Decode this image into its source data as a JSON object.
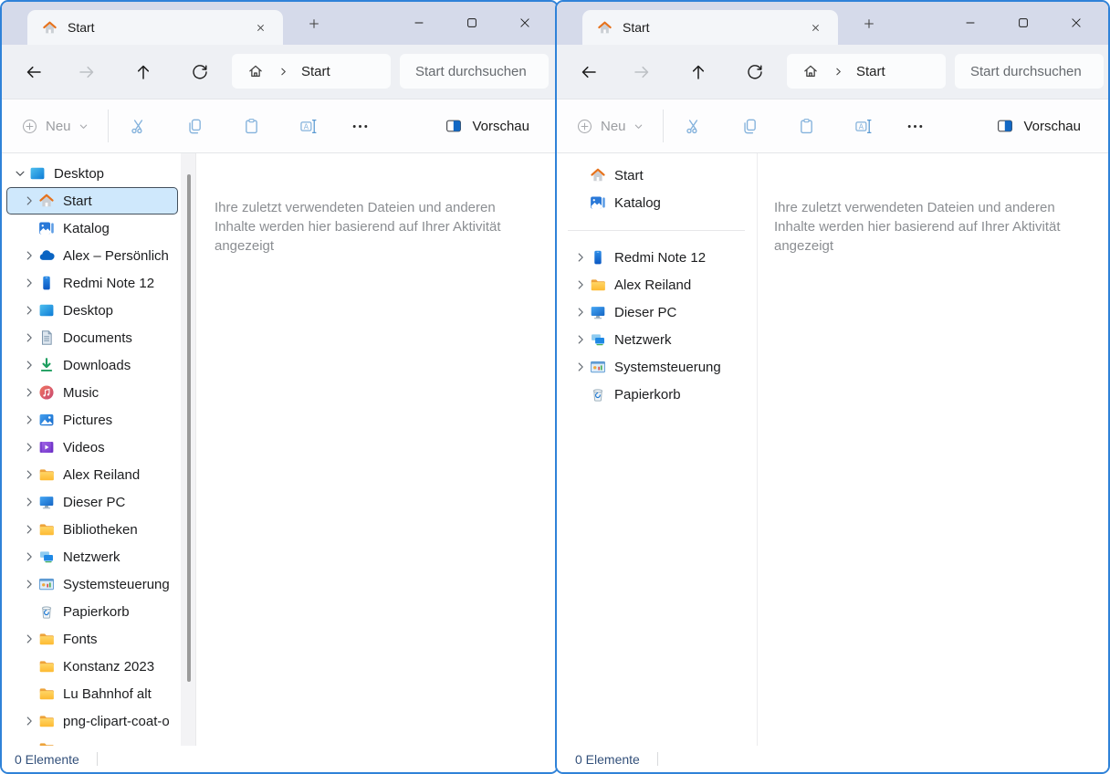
{
  "colors": {
    "window_border_accent": "#2f82d8",
    "tabbar_bg": "#d5daea",
    "navbar_bg": "#eef0f4",
    "selection_bg": "#cfe8fc",
    "selection_outline": "#44505c",
    "toolbar_icon_blue": "#84b2dc",
    "hint_text": "#8b8e92",
    "status_text": "#33507a"
  },
  "icons": {
    "home-icon": "house with orange roof",
    "gallery-icon": "blue photo gallery square",
    "onedrive-icon": "blue cloud",
    "phone-icon": "blue smartphone",
    "desktop-icon": "blue screen",
    "document-icon": "page with lines",
    "download-icon": "green down arrow",
    "music-icon": "red circle with note",
    "pictures-icon": "blue square with mountain",
    "videos-icon": "purple film frame",
    "folder-icon": "yellow folder",
    "monitor-icon": "monitor with stand",
    "network-icon": "two networked screens",
    "controlpanel-icon": "settings panel with chart",
    "recyclebin-icon": "bin with recycle arrows",
    "chevron-right-icon": "›",
    "chevron-down-icon": "⌄",
    "back-icon": "←",
    "forward-icon": "→",
    "up-icon": "↑",
    "refresh-icon": "⟳",
    "plus-circle-icon": "⊕",
    "cut-icon": "scissors",
    "copy-icon": "two sheets",
    "paste-icon": "clipboard",
    "rename-icon": "A with caret",
    "more-icon": "•••",
    "preview-icon": "split pane square",
    "minimize-icon": "─",
    "maximize-icon": "□",
    "close-icon": "✕",
    "new-tab-icon": "+"
  },
  "windows": {
    "left": {
      "tab": {
        "title": "Start"
      },
      "nav": {
        "breadcrumb_item": "Start",
        "search_placeholder": "Start durchsuchen"
      },
      "toolbar": {
        "new_label": "Neu",
        "preview_label": "Vorschau"
      },
      "main": {
        "empty_hint": "Ihre zuletzt verwendeten Dateien und anderen Inhalte werden hier basierend auf Ihrer Aktivität angezeigt"
      },
      "status": {
        "items": "0 Elemente"
      },
      "tree": [
        {
          "label": "Desktop",
          "icon": "desktop-icon",
          "chevron": "down",
          "indent": 0
        },
        {
          "label": "Start",
          "icon": "home-icon",
          "chevron": "right",
          "indent": 1,
          "selected": true
        },
        {
          "label": "Katalog",
          "icon": "gallery-icon",
          "indent": 1
        },
        {
          "label": "Alex – Persönlich",
          "icon": "onedrive-icon",
          "chevron": "right",
          "indent": 1
        },
        {
          "label": "Redmi Note 12",
          "icon": "phone-icon",
          "chevron": "right",
          "indent": 1
        },
        {
          "label": "Desktop",
          "icon": "desktop-icon",
          "chevron": "right",
          "indent": 1
        },
        {
          "label": "Documents",
          "icon": "document-icon",
          "chevron": "right",
          "indent": 1
        },
        {
          "label": "Downloads",
          "icon": "download-icon",
          "chevron": "right",
          "indent": 1
        },
        {
          "label": "Music",
          "icon": "music-icon",
          "chevron": "right",
          "indent": 1
        },
        {
          "label": "Pictures",
          "icon": "pictures-icon",
          "chevron": "right",
          "indent": 1
        },
        {
          "label": "Videos",
          "icon": "videos-icon",
          "chevron": "right",
          "indent": 1
        },
        {
          "label": "Alex Reiland",
          "icon": "folder-icon",
          "chevron": "right",
          "indent": 1
        },
        {
          "label": "Dieser PC",
          "icon": "monitor-icon",
          "chevron": "right",
          "indent": 1
        },
        {
          "label": "Bibliotheken",
          "icon": "folder-icon",
          "chevron": "right",
          "indent": 1
        },
        {
          "label": "Netzwerk",
          "icon": "network-icon",
          "chevron": "right",
          "indent": 1
        },
        {
          "label": "Systemsteuerung",
          "icon": "controlpanel-icon",
          "chevron": "right",
          "indent": 1
        },
        {
          "label": "Papierkorb",
          "icon": "recyclebin-icon",
          "indent": 1
        },
        {
          "label": "Fonts",
          "icon": "folder-icon",
          "chevron": "right",
          "indent": 1
        },
        {
          "label": "Konstanz 2023",
          "icon": "folder-icon",
          "indent": 1
        },
        {
          "label": "Lu Bahnhof alt",
          "icon": "folder-icon",
          "indent": 1
        },
        {
          "label": "png-clipart-coat-o",
          "icon": "folder-icon",
          "chevron": "right",
          "indent": 1
        },
        {
          "label": "",
          "icon": "folder-icon",
          "indent": 1,
          "partial": true
        }
      ]
    },
    "right": {
      "tab": {
        "title": "Start"
      },
      "nav": {
        "breadcrumb_item": "Start",
        "search_placeholder": "Start durchsuchen"
      },
      "toolbar": {
        "new_label": "Neu",
        "preview_label": "Vorschau"
      },
      "main": {
        "empty_hint": "Ihre zuletzt verwendeten Dateien und anderen Inhalte werden hier basierend auf Ihrer Aktivität angezeigt"
      },
      "status": {
        "items": "0 Elemente"
      },
      "tree": [
        {
          "label": "Start",
          "icon": "home-icon",
          "indent": 1
        },
        {
          "label": "Katalog",
          "icon": "gallery-icon",
          "indent": 1
        },
        {
          "separator": true
        },
        {
          "label": "Redmi Note 12",
          "icon": "phone-icon",
          "chevron": "right",
          "indent": 1
        },
        {
          "label": "Alex Reiland",
          "icon": "folder-icon",
          "chevron": "right",
          "indent": 1
        },
        {
          "label": "Dieser PC",
          "icon": "monitor-icon",
          "chevron": "right",
          "indent": 1
        },
        {
          "label": "Netzwerk",
          "icon": "network-icon",
          "chevron": "right",
          "indent": 1
        },
        {
          "label": "Systemsteuerung",
          "icon": "controlpanel-icon",
          "chevron": "right",
          "indent": 1
        },
        {
          "label": "Papierkorb",
          "icon": "recyclebin-icon",
          "indent": 1
        }
      ]
    }
  }
}
